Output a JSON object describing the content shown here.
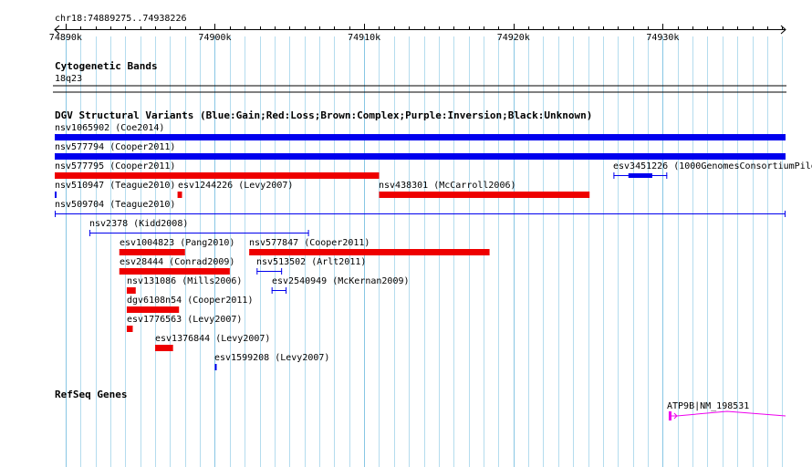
{
  "ruler": {
    "region": "chr18:74889275..74938226",
    "start": 74889275,
    "end": 74938226,
    "ticks": [
      {
        "pos": 74890000,
        "label": "74890k"
      },
      {
        "pos": 74900000,
        "label": "74900k"
      },
      {
        "pos": 74910000,
        "label": "74910k"
      },
      {
        "pos": 74920000,
        "label": "74920k"
      },
      {
        "pos": 74930000,
        "label": "74930k"
      }
    ]
  },
  "cytoband": {
    "title": "Cytogenetic Bands",
    "band": "18q23"
  },
  "dgv": {
    "title": "DGV Structural Variants (Blue:Gain;Red:Loss;Brown:Complex;Purple:Inversion;Black:Unknown)",
    "colors": {
      "gain": "#0000ee",
      "loss": "#ee0000"
    },
    "features": [
      {
        "name": "nsv1065902 (Coe2014)",
        "type": "gain",
        "style": "bar",
        "row": 0,
        "start": 74889275,
        "end": 74938226
      },
      {
        "name": "nsv577794 (Cooper2011)",
        "type": "gain",
        "style": "bar",
        "row": 1,
        "start": 74889275,
        "end": 74938226
      },
      {
        "name": "nsv577795 (Cooper2011)",
        "type": "loss",
        "style": "bar",
        "row": 2,
        "start": 74889275,
        "end": 74911000
      },
      {
        "name": "esv3451226 (1000GenomesConsortiumPilo",
        "type": "gain",
        "style": "segmented",
        "row": 2,
        "start": 74926700,
        "end": 74930300,
        "core": [
          74927700,
          74929300
        ]
      },
      {
        "name": "nsv510947 (Teague2010)",
        "type": "gain",
        "style": "tick",
        "row": 3,
        "start": 74889275,
        "end": 74889400
      },
      {
        "name": "esv1244226 (Levy2007)",
        "type": "loss",
        "style": "bar",
        "row": 3,
        "start": 74897500,
        "end": 74897800
      },
      {
        "name": "nsv438301 (McCarroll2006)",
        "type": "loss",
        "style": "bar",
        "row": 3,
        "start": 74911000,
        "end": 74925100
      },
      {
        "name": "nsv509704 (Teague2010)",
        "type": "gain",
        "style": "line",
        "row": 4,
        "start": 74889275,
        "end": 74938226
      },
      {
        "name": "nsv2378 (Kidd2008)",
        "type": "gain",
        "style": "line",
        "row": 5,
        "start": 74891600,
        "end": 74906300
      },
      {
        "name": "esv1004823 (Pang2010)",
        "type": "loss",
        "style": "bar",
        "row": 6,
        "start": 74893600,
        "end": 74898000
      },
      {
        "name": "nsv577847 (Cooper2011)",
        "type": "loss",
        "style": "bar",
        "row": 6,
        "start": 74902300,
        "end": 74918400
      },
      {
        "name": "esv28444 (Conrad2009)",
        "type": "loss",
        "style": "bar",
        "row": 7,
        "start": 74893600,
        "end": 74901000
      },
      {
        "name": "nsv513502 (Arlt2011)",
        "type": "gain",
        "style": "line",
        "row": 7,
        "start": 74902800,
        "end": 74904500
      },
      {
        "name": "nsv131086 (Mills2006)",
        "type": "loss",
        "style": "bar",
        "row": 8,
        "start": 74894100,
        "end": 74894700
      },
      {
        "name": "esv2540949 (McKernan2009)",
        "type": "gain",
        "style": "line",
        "row": 8,
        "start": 74903800,
        "end": 74904800
      },
      {
        "name": "dgv6108n54 (Cooper2011)",
        "type": "loss",
        "style": "bar",
        "row": 9,
        "start": 74894100,
        "end": 74897600
      },
      {
        "name": "esv1776563 (Levy2007)",
        "type": "loss",
        "style": "bar",
        "row": 10,
        "start": 74894100,
        "end": 74894500
      },
      {
        "name": "esv1376844 (Levy2007)",
        "type": "loss",
        "style": "bar",
        "row": 11,
        "start": 74896000,
        "end": 74897200
      },
      {
        "name": "esv1599208 (Levy2007)",
        "type": "gain",
        "style": "tick",
        "row": 12,
        "start": 74900000,
        "end": 74900200
      }
    ]
  },
  "refseq": {
    "title": "RefSeq Genes",
    "gene": {
      "name": "ATP9B|NM_198531",
      "start": 74930400,
      "end": 74938226,
      "color": "#ee00ee"
    }
  },
  "grid": {
    "minor_step": 1000,
    "minor_color": "#b4dcee",
    "major_color": "#87c6e4"
  }
}
